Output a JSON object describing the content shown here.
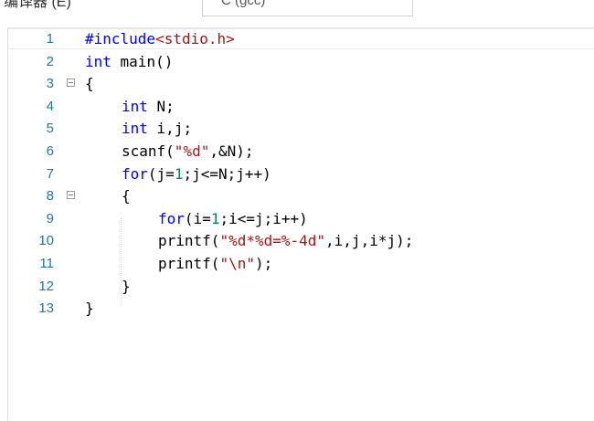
{
  "header": {
    "label": "编译器 (E)",
    "language_selected": "C (gcc)"
  },
  "editor": {
    "lines": [
      {
        "n": "1",
        "fold": false,
        "indent": 0,
        "tokens": [
          {
            "t": "#include",
            "c": "kw"
          },
          {
            "t": "<stdio.h>",
            "c": "str"
          }
        ]
      },
      {
        "n": "2",
        "fold": false,
        "indent": 0,
        "tokens": [
          {
            "t": "int",
            "c": "kw"
          },
          {
            "t": " main()",
            "c": ""
          }
        ]
      },
      {
        "n": "3",
        "fold": true,
        "indent": 0,
        "tokens": [
          {
            "t": "{",
            "c": ""
          }
        ]
      },
      {
        "n": "4",
        "fold": false,
        "indent": 1,
        "tokens": [
          {
            "t": "int",
            "c": "kw"
          },
          {
            "t": " N;",
            "c": ""
          }
        ]
      },
      {
        "n": "5",
        "fold": false,
        "indent": 1,
        "tokens": [
          {
            "t": "int",
            "c": "kw"
          },
          {
            "t": " i,j;",
            "c": ""
          }
        ]
      },
      {
        "n": "6",
        "fold": false,
        "indent": 1,
        "tokens": [
          {
            "t": "scanf(",
            "c": ""
          },
          {
            "t": "\"%d\"",
            "c": "str"
          },
          {
            "t": ",&N);",
            "c": ""
          }
        ]
      },
      {
        "n": "7",
        "fold": false,
        "indent": 1,
        "tokens": [
          {
            "t": "for",
            "c": "kw"
          },
          {
            "t": "(j=",
            "c": ""
          },
          {
            "t": "1",
            "c": "num"
          },
          {
            "t": ";j<=N;j++)",
            "c": ""
          }
        ]
      },
      {
        "n": "8",
        "fold": true,
        "indent": 1,
        "tokens": [
          {
            "t": "{",
            "c": ""
          }
        ]
      },
      {
        "n": "9",
        "fold": false,
        "indent": 2,
        "tokens": [
          {
            "t": "for",
            "c": "kw"
          },
          {
            "t": "(i=",
            "c": ""
          },
          {
            "t": "1",
            "c": "num"
          },
          {
            "t": ";i<=j;i++)",
            "c": ""
          }
        ]
      },
      {
        "n": "10",
        "fold": false,
        "indent": 2,
        "tokens": [
          {
            "t": "printf(",
            "c": ""
          },
          {
            "t": "\"%d*%d=%-4d\"",
            "c": "str"
          },
          {
            "t": ",i,j,i*j);",
            "c": ""
          }
        ]
      },
      {
        "n": "11",
        "fold": false,
        "indent": 2,
        "tokens": [
          {
            "t": "printf(",
            "c": ""
          },
          {
            "t": "\"\\n\"",
            "c": "str"
          },
          {
            "t": ");",
            "c": ""
          }
        ]
      },
      {
        "n": "12",
        "fold": false,
        "indent": 1,
        "tokens": [
          {
            "t": "}",
            "c": ""
          }
        ]
      },
      {
        "n": "13",
        "fold": false,
        "indent": 0,
        "tokens": [
          {
            "t": "}",
            "c": ""
          }
        ]
      }
    ]
  }
}
